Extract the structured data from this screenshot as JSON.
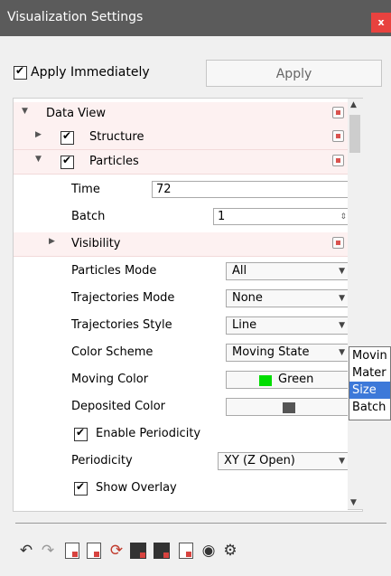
{
  "window": {
    "title": "Visualization Settings",
    "close_label": "x"
  },
  "top": {
    "apply_immediately_label": "Apply Immediately",
    "apply_immediately_checked": true,
    "apply_button_label": "Apply"
  },
  "tree": {
    "data_view": "Data View",
    "structure": "Structure",
    "particles": "Particles",
    "time_label": "Time",
    "time_value": "72",
    "batch_label": "Batch",
    "batch_value": "1",
    "visibility": "Visibility",
    "particles_mode_label": "Particles Mode",
    "particles_mode_value": "All",
    "trajectories_mode_label": "Trajectories Mode",
    "trajectories_mode_value": "None",
    "trajectories_style_label": "Trajectories Style",
    "trajectories_style_value": "Line",
    "color_scheme_label": "Color Scheme",
    "color_scheme_value": "Moving State",
    "moving_color_label": "Moving Color",
    "moving_color_value": "Green",
    "moving_color_hex": "#00dd00",
    "deposited_color_label": "Deposited Color",
    "deposited_color_hex": "#555555",
    "enable_periodicity_label": "Enable Periodicity",
    "periodicity_label": "Periodicity",
    "periodicity_value": "XY (Z Open)",
    "show_overlay_label": "Show Overlay"
  },
  "popup": {
    "options": [
      "Movin",
      "Mater",
      "Size",
      "Batch"
    ],
    "selected_index": 2
  },
  "toolbar": {
    "icons": [
      "undo-icon",
      "redo-icon",
      "reset-settings-icon",
      "reset-view-icon",
      "refresh-icon",
      "save-image-icon",
      "save-settings-icon",
      "export-icon",
      "eye-icon",
      "gear-icon"
    ]
  },
  "colors": {
    "titlebar": "#5b5b5b",
    "close": "#e8423f",
    "row_pink": "#fdf1f1",
    "selection": "#3d79d9"
  }
}
